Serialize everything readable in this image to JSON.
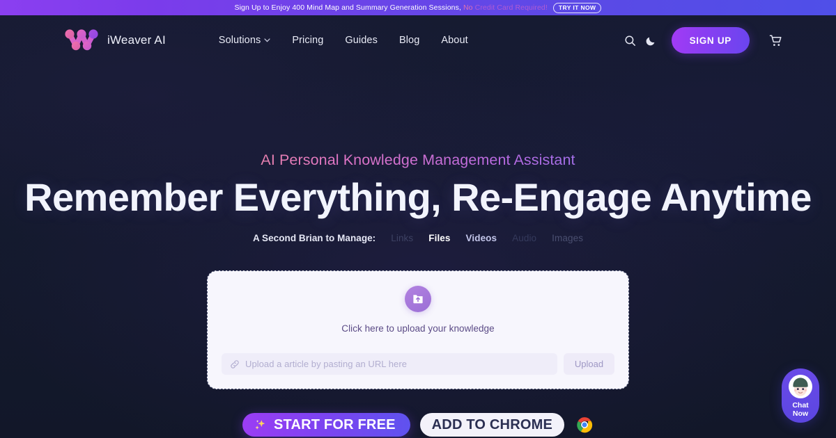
{
  "promo": {
    "text_main": "Sign Up to Enjoy 400 Mind Map and Summary Generation Sessions,",
    "text_accent": "No",
    "text_accent2": "Credit Card Required!",
    "button_label": "TRY IT NOW",
    "bg_gradient_from": "#8b3ff0",
    "bg_gradient_to": "#4f4fe8"
  },
  "header": {
    "brand_name": "iWeaver AI",
    "nav": [
      {
        "label": "Solutions",
        "has_dropdown": true
      },
      {
        "label": "Pricing",
        "has_dropdown": false
      },
      {
        "label": "Guides",
        "has_dropdown": false
      },
      {
        "label": "Blog",
        "has_dropdown": false
      },
      {
        "label": "About",
        "has_dropdown": false
      }
    ],
    "search_icon": "search-icon",
    "theme_icon": "moon-icon",
    "cart_icon": "shopping-cart-icon",
    "signup_label": "SIGN UP",
    "signup_color": "#8a3ef2"
  },
  "hero": {
    "eyebrow": "AI Personal Knowledge Management Assistant",
    "headline": "Remember Everything, Re-Engage Anytime",
    "subline_label": "A Second Brian to Manage:",
    "rotator_words": [
      "Links",
      "Files",
      "Videos",
      "Audio",
      "Images"
    ],
    "active_word": "Files"
  },
  "upload": {
    "icon": "file-upload-icon",
    "caption": "Click here to upload your knowledge",
    "url_icon": "link-icon",
    "url_placeholder": "Upload a article by pasting an URL here",
    "url_value": "",
    "upload_button": "Upload",
    "card_bg": "#f7f6fd"
  },
  "cta": {
    "primary_icon": "sparkle-icon",
    "primary_label": "START FOR FREE",
    "secondary_label": "ADD TO CHROME",
    "secondary_icon": "chrome-logo-icon"
  },
  "chat": {
    "avatar_icon": "support-agent-avatar",
    "line1": "Chat",
    "line2": "Now"
  }
}
